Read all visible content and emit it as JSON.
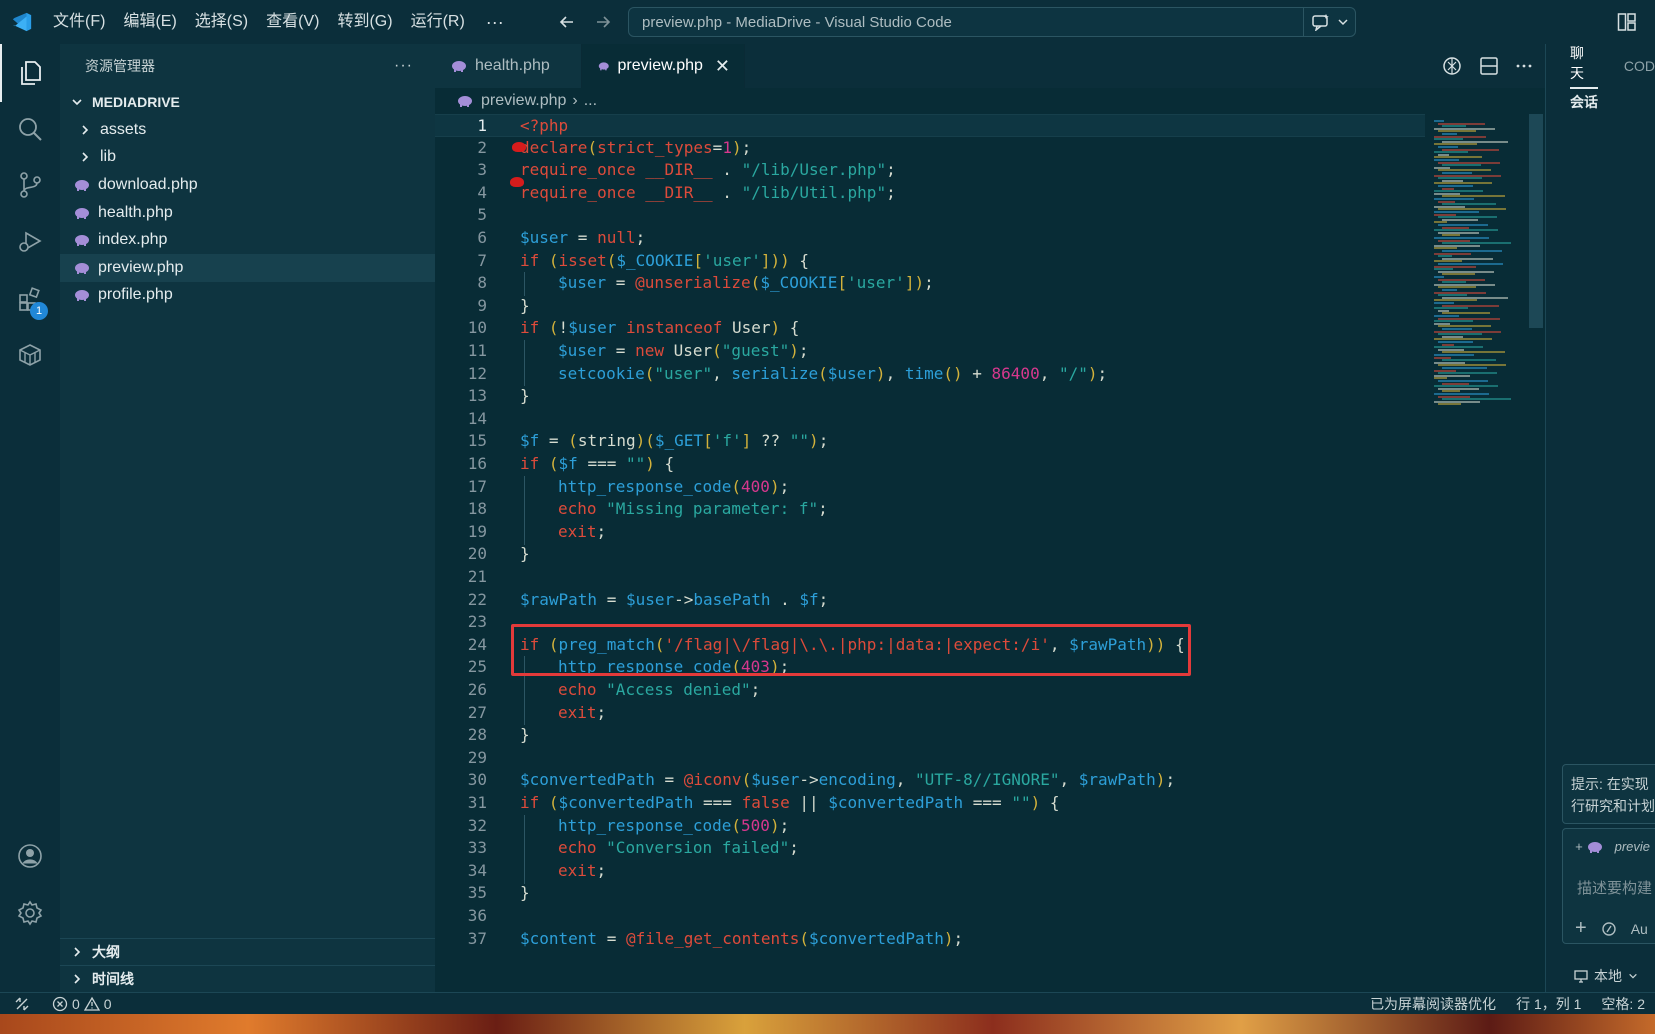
{
  "titlebar": {
    "menus": [
      "文件(F)",
      "编辑(E)",
      "选择(S)",
      "查看(V)",
      "转到(G)",
      "运行(R)"
    ],
    "more": "···",
    "command_center": "preview.php - MediaDrive - Visual Studio Code"
  },
  "activity": {
    "items": [
      "explorer-icon",
      "search-icon",
      "source-control-icon",
      "run-debug-icon",
      "extensions-icon",
      "remote-explorer-icon",
      "account-icon",
      "settings-gear-icon"
    ],
    "extensions_badge": "1"
  },
  "sidebar": {
    "title": "资源管理器",
    "more": "···",
    "root": "MEDIADRIVE",
    "folders": [
      "assets",
      "lib"
    ],
    "files": [
      "download.php",
      "health.php",
      "index.php",
      "preview.php",
      "profile.php"
    ],
    "selected": "preview.php",
    "outline": "大纲",
    "timeline": "时间线"
  },
  "editor": {
    "tabs": [
      {
        "label": "health.php",
        "active": false
      },
      {
        "label": "preview.php",
        "active": true
      }
    ],
    "close_glyph": "✕",
    "breadcrumb": {
      "file": "preview.php",
      "sep": "›",
      "rest": "..."
    },
    "lines": [
      {
        "n": "1",
        "indent": 0,
        "tokens": [
          [
            "t-php",
            "<?php"
          ]
        ]
      },
      {
        "n": "2",
        "indent": 0,
        "tokens": [
          [
            "t-kw",
            "declare"
          ],
          [
            "t-brk",
            "("
          ],
          [
            "t-kw",
            "strict_types"
          ],
          [
            "",
            "="
          ],
          [
            "t-num",
            "1"
          ],
          [
            "t-brk",
            ")"
          ],
          [
            "",
            ";"
          ]
        ]
      },
      {
        "n": "3",
        "indent": 0,
        "tokens": [
          [
            "t-kw",
            "require_once"
          ],
          [
            "",
            " "
          ],
          [
            "t-kw",
            "__DIR__"
          ],
          [
            "",
            " . "
          ],
          [
            "t-str",
            "\"/lib/User.php\""
          ],
          [
            "",
            ";"
          ]
        ]
      },
      {
        "n": "4",
        "indent": 0,
        "tokens": [
          [
            "t-kw",
            "require_once"
          ],
          [
            "",
            " "
          ],
          [
            "t-kw",
            "__DIR__"
          ],
          [
            "",
            " . "
          ],
          [
            "t-str",
            "\"/lib/Util.php\""
          ],
          [
            "",
            ";"
          ]
        ]
      },
      {
        "n": "5",
        "indent": 0,
        "tokens": []
      },
      {
        "n": "6",
        "indent": 0,
        "tokens": [
          [
            "t-var",
            "$user"
          ],
          [
            "",
            " = "
          ],
          [
            "t-kw",
            "null"
          ],
          [
            "",
            ";"
          ]
        ]
      },
      {
        "n": "7",
        "indent": 0,
        "tokens": [
          [
            "t-kw",
            "if"
          ],
          [
            "",
            " "
          ],
          [
            "t-brk",
            "("
          ],
          [
            "t-kw",
            "isset"
          ],
          [
            "t-brk",
            "("
          ],
          [
            "t-var",
            "$_COOKIE"
          ],
          [
            "t-brk",
            "["
          ],
          [
            "t-str",
            "'user'"
          ],
          [
            "t-brk",
            "]"
          ],
          [
            "t-brk",
            ")"
          ],
          [
            "t-brk",
            ")"
          ],
          [
            "",
            " {"
          ]
        ]
      },
      {
        "n": "8",
        "indent": 1,
        "tokens": [
          [
            "t-var",
            "$user"
          ],
          [
            "",
            " = "
          ],
          [
            "t-kw",
            "@unserialize"
          ],
          [
            "t-brk",
            "("
          ],
          [
            "t-var",
            "$_COOKIE"
          ],
          [
            "t-brk",
            "["
          ],
          [
            "t-str",
            "'user'"
          ],
          [
            "t-brk",
            "]"
          ],
          [
            "t-brk",
            ")"
          ],
          [
            "",
            ";"
          ]
        ]
      },
      {
        "n": "9",
        "indent": 0,
        "tokens": [
          [
            "",
            "}"
          ]
        ]
      },
      {
        "n": "10",
        "indent": 0,
        "tokens": [
          [
            "t-kw",
            "if"
          ],
          [
            "",
            " "
          ],
          [
            "t-brk",
            "("
          ],
          [
            "",
            "!"
          ],
          [
            "t-var",
            "$user"
          ],
          [
            "",
            " "
          ],
          [
            "t-kw",
            "instanceof"
          ],
          [
            "",
            " User"
          ],
          [
            "t-brk",
            ")"
          ],
          [
            "",
            " {"
          ]
        ]
      },
      {
        "n": "11",
        "indent": 1,
        "tokens": [
          [
            "t-var",
            "$user"
          ],
          [
            "",
            " = "
          ],
          [
            "t-kw",
            "new"
          ],
          [
            "",
            " User"
          ],
          [
            "t-brk",
            "("
          ],
          [
            "t-str",
            "\"guest\""
          ],
          [
            "t-brk",
            ")"
          ],
          [
            "",
            ";"
          ]
        ]
      },
      {
        "n": "12",
        "indent": 1,
        "tokens": [
          [
            "t-fn",
            "setcookie"
          ],
          [
            "t-brk",
            "("
          ],
          [
            "t-str",
            "\"user\""
          ],
          [
            "",
            ", "
          ],
          [
            "t-fn",
            "serialize"
          ],
          [
            "t-brk",
            "("
          ],
          [
            "t-var",
            "$user"
          ],
          [
            "t-brk",
            ")"
          ],
          [
            "",
            ", "
          ],
          [
            "t-fn",
            "time"
          ],
          [
            "t-brk",
            "()"
          ],
          [
            "",
            " + "
          ],
          [
            "t-num",
            "86400"
          ],
          [
            "",
            ", "
          ],
          [
            "t-str",
            "\"/\""
          ],
          [
            "t-brk",
            ")"
          ],
          [
            "",
            ";"
          ]
        ]
      },
      {
        "n": "13",
        "indent": 0,
        "tokens": [
          [
            "",
            "}"
          ]
        ]
      },
      {
        "n": "14",
        "indent": 0,
        "tokens": []
      },
      {
        "n": "15",
        "indent": 0,
        "tokens": [
          [
            "t-var",
            "$f"
          ],
          [
            "",
            " = "
          ],
          [
            "t-brk",
            "("
          ],
          [
            "t-cmt",
            "string"
          ],
          [
            "t-brk",
            ")"
          ],
          [
            "t-brk",
            "("
          ],
          [
            "t-var",
            "$_GET"
          ],
          [
            "t-brk",
            "["
          ],
          [
            "t-str",
            "'f'"
          ],
          [
            "t-brk",
            "]"
          ],
          [
            "",
            " ?? "
          ],
          [
            "t-str",
            "\"\""
          ],
          [
            "t-brk",
            ")"
          ],
          [
            "",
            ";"
          ]
        ]
      },
      {
        "n": "16",
        "indent": 0,
        "tokens": [
          [
            "t-kw",
            "if"
          ],
          [
            "",
            " "
          ],
          [
            "t-brk",
            "("
          ],
          [
            "t-var",
            "$f"
          ],
          [
            "",
            " === "
          ],
          [
            "t-str",
            "\"\""
          ],
          [
            "t-brk",
            ")"
          ],
          [
            "",
            " {"
          ]
        ]
      },
      {
        "n": "17",
        "indent": 1,
        "tokens": [
          [
            "t-fn",
            "http_response_code"
          ],
          [
            "t-brk",
            "("
          ],
          [
            "t-num",
            "400"
          ],
          [
            "t-brk",
            ")"
          ],
          [
            "",
            ";"
          ]
        ]
      },
      {
        "n": "18",
        "indent": 1,
        "tokens": [
          [
            "t-kw",
            "echo"
          ],
          [
            "",
            " "
          ],
          [
            "t-str",
            "\"Missing parameter: f\""
          ],
          [
            "",
            ";"
          ]
        ]
      },
      {
        "n": "19",
        "indent": 1,
        "tokens": [
          [
            "t-kw",
            "exit"
          ],
          [
            "",
            ";"
          ]
        ]
      },
      {
        "n": "20",
        "indent": 0,
        "tokens": [
          [
            "",
            "}"
          ]
        ]
      },
      {
        "n": "21",
        "indent": 0,
        "tokens": []
      },
      {
        "n": "22",
        "indent": 0,
        "tokens": [
          [
            "t-var",
            "$rawPath"
          ],
          [
            "",
            " = "
          ],
          [
            "t-var",
            "$user"
          ],
          [
            "",
            "->"
          ],
          [
            "t-var",
            "basePath"
          ],
          [
            "",
            " . "
          ],
          [
            "t-var",
            "$f"
          ],
          [
            "",
            ";"
          ]
        ]
      },
      {
        "n": "23",
        "indent": 0,
        "tokens": []
      },
      {
        "n": "24",
        "indent": 0,
        "tokens": [
          [
            "t-kw",
            "if"
          ],
          [
            "",
            " "
          ],
          [
            "t-brk",
            "("
          ],
          [
            "t-fn",
            "preg_match"
          ],
          [
            "t-brk",
            "("
          ],
          [
            "t-kw",
            "'/flag|\\/flag|\\.\\.|php:|data:|expect:/i'"
          ],
          [
            "",
            ", "
          ],
          [
            "t-var",
            "$rawPath"
          ],
          [
            "t-brk",
            ")"
          ],
          [
            "t-brk",
            ")"
          ],
          [
            "",
            " {"
          ]
        ]
      },
      {
        "n": "25",
        "indent": 1,
        "tokens": [
          [
            "t-fn",
            "http_response_code"
          ],
          [
            "t-brk",
            "("
          ],
          [
            "t-num",
            "403"
          ],
          [
            "t-brk",
            ")"
          ],
          [
            "",
            ";"
          ]
        ]
      },
      {
        "n": "26",
        "indent": 1,
        "tokens": [
          [
            "t-kw",
            "echo"
          ],
          [
            "",
            " "
          ],
          [
            "t-str",
            "\"Access denied\""
          ],
          [
            "",
            ";"
          ]
        ]
      },
      {
        "n": "27",
        "indent": 1,
        "tokens": [
          [
            "t-kw",
            "exit"
          ],
          [
            "",
            ";"
          ]
        ]
      },
      {
        "n": "28",
        "indent": 0,
        "tokens": [
          [
            "",
            "}"
          ]
        ]
      },
      {
        "n": "29",
        "indent": 0,
        "tokens": []
      },
      {
        "n": "30",
        "indent": 0,
        "tokens": [
          [
            "t-var",
            "$convertedPath"
          ],
          [
            "",
            " = "
          ],
          [
            "t-kw",
            "@iconv"
          ],
          [
            "t-brk",
            "("
          ],
          [
            "t-var",
            "$user"
          ],
          [
            "",
            "->"
          ],
          [
            "t-var",
            "encoding"
          ],
          [
            "",
            ", "
          ],
          [
            "t-str",
            "\"UTF-8//IGNORE\""
          ],
          [
            "",
            ", "
          ],
          [
            "t-var",
            "$rawPath"
          ],
          [
            "t-brk",
            ")"
          ],
          [
            "",
            ";"
          ]
        ]
      },
      {
        "n": "31",
        "indent": 0,
        "tokens": [
          [
            "t-kw",
            "if"
          ],
          [
            "",
            " "
          ],
          [
            "t-brk",
            "("
          ],
          [
            "t-var",
            "$convertedPath"
          ],
          [
            "",
            " === "
          ],
          [
            "t-kw",
            "false"
          ],
          [
            "",
            " || "
          ],
          [
            "t-var",
            "$convertedPath"
          ],
          [
            "",
            " === "
          ],
          [
            "t-str",
            "\"\""
          ],
          [
            "t-brk",
            ")"
          ],
          [
            "",
            " {"
          ]
        ]
      },
      {
        "n": "32",
        "indent": 1,
        "tokens": [
          [
            "t-fn",
            "http_response_code"
          ],
          [
            "t-brk",
            "("
          ],
          [
            "t-num",
            "500"
          ],
          [
            "t-brk",
            ")"
          ],
          [
            "",
            ";"
          ]
        ]
      },
      {
        "n": "33",
        "indent": 1,
        "tokens": [
          [
            "t-kw",
            "echo"
          ],
          [
            "",
            " "
          ],
          [
            "t-str",
            "\"Conversion failed\""
          ],
          [
            "",
            ";"
          ]
        ]
      },
      {
        "n": "34",
        "indent": 1,
        "tokens": [
          [
            "t-kw",
            "exit"
          ],
          [
            "",
            ";"
          ]
        ]
      },
      {
        "n": "35",
        "indent": 0,
        "tokens": [
          [
            "",
            "}"
          ]
        ]
      },
      {
        "n": "36",
        "indent": 0,
        "tokens": []
      },
      {
        "n": "37",
        "indent": 0,
        "tokens": [
          [
            "t-var",
            "$content"
          ],
          [
            "",
            " = "
          ],
          [
            "t-kw",
            "@file_get_contents"
          ],
          [
            "t-brk",
            "("
          ],
          [
            "t-var",
            "$convertedPath"
          ],
          [
            "t-brk",
            ")"
          ],
          [
            "",
            ";"
          ]
        ]
      }
    ],
    "highlighted_line": "24",
    "current_line": "1"
  },
  "chat": {
    "tab_chat": "聊天",
    "tab_code": "COD",
    "session": "会话",
    "tip_line1": "提示: 在实现",
    "tip_line2": "行研究和计划",
    "attachment": "previe",
    "input_placeholder": "描述要构建",
    "tool_auto": "Au",
    "local_label": "本地"
  },
  "statusbar": {
    "errors": "0",
    "warnings": "0",
    "screen_reader": "已为屏幕阅读器优化",
    "position": "行 1，列 1",
    "spaces": "空格: 2"
  },
  "colors": {
    "accent_red": "#e33a3a",
    "php_icon": "#a48ed8",
    "badge_blue": "#2188d8"
  }
}
